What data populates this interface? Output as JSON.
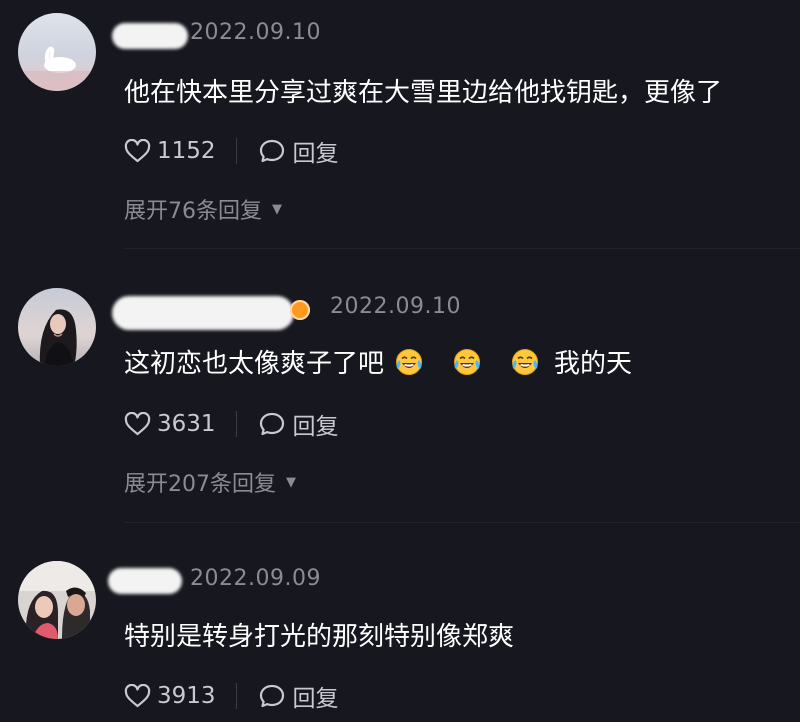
{
  "comments": [
    {
      "date": "2022.09.10",
      "text": "他在快本里分享过爽在大雪里边给他找钥匙，更像了",
      "likes": "1152",
      "reply_label": "回复",
      "expand": "展开76条回复",
      "avatar": "swan-avatar"
    },
    {
      "date": "2022.09.10",
      "text_before": "这初恋也太像爽子了吧",
      "text_after": "我的天",
      "emojis": [
        "crying-laugh-emoji",
        "crying-laugh-emoji",
        "crying-laugh-emoji"
      ],
      "likes": "3631",
      "reply_label": "回复",
      "expand": "展开207条回复",
      "avatar": "girl-avatar"
    },
    {
      "date": "2022.09.09",
      "text": "特别是转身打光的那刻特别像郑爽",
      "likes": "3913",
      "reply_label": "回复",
      "avatar": "couple-avatar"
    }
  ],
  "colors": {
    "background": "#16171f",
    "text": "#ffffff",
    "muted": "#8a8b93",
    "action": "#c9cad0",
    "badge": "#ff9a1f"
  }
}
